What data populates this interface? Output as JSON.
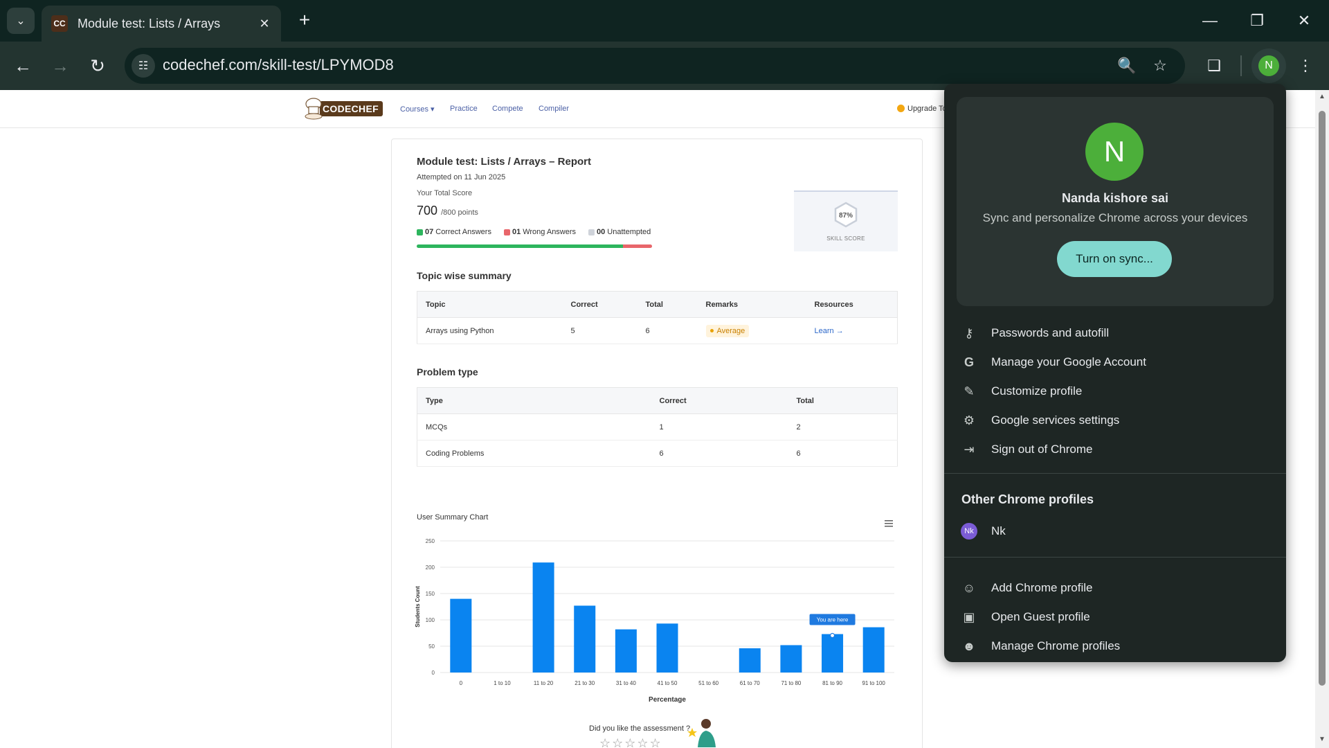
{
  "browser": {
    "tab_title": "Module test: Lists / Arrays",
    "tab_favicon": "CC",
    "url": "codechef.com/skill-test/LPYMOD8",
    "avatar_initial": "N"
  },
  "site": {
    "logo_text": "CODECHEF",
    "nav": [
      "Courses",
      "Practice",
      "Compete",
      "Compiler"
    ],
    "upgrade": "Upgrade To"
  },
  "report": {
    "title": "Module test: Lists / Arrays – Report",
    "attempted": "Attempted on 11 Jun 2025",
    "total_label": "Your Total Score",
    "score": "700",
    "score_max": "/800 points",
    "correct_count": "07",
    "correct_label": "Correct Answers",
    "wrong_count": "01",
    "wrong_label": "Wrong Answers",
    "unattempted_count": "00",
    "unattempted_label": "Unattempted",
    "progress_correct_fraction": 0.875,
    "progress_wrong_fraction": 0.125,
    "skill_percent": "87%",
    "skill_label": "SKILL SCORE",
    "colors": {
      "correct": "#2db55d",
      "wrong": "#e8666b",
      "unattempted": "#cfd3da"
    }
  },
  "topic_summary": {
    "title": "Topic wise summary",
    "headers": [
      "Topic",
      "Correct",
      "Total",
      "Remarks",
      "Resources"
    ],
    "rows": [
      {
        "topic": "Arrays using Python",
        "correct": "5",
        "total": "6",
        "remarks": "Average",
        "resources": "Learn →"
      }
    ]
  },
  "problem_type": {
    "title": "Problem type",
    "headers": [
      "Type",
      "Correct",
      "Total"
    ],
    "rows": [
      {
        "type": "MCQs",
        "correct": "1",
        "total": "2"
      },
      {
        "type": "Coding Problems",
        "correct": "6",
        "total": "6"
      }
    ]
  },
  "chart_data": {
    "type": "bar",
    "title": "User Summary Chart",
    "xlabel": "Percentage",
    "ylabel": "Students Count",
    "categories": [
      "0",
      "1 to 10",
      "11 to 20",
      "21 to 30",
      "31 to 40",
      "41 to 50",
      "51 to 60",
      "61 to 70",
      "71 to 80",
      "81 to 90",
      "91 to 100"
    ],
    "values": [
      140,
      0,
      209,
      127,
      82,
      93,
      0,
      46,
      52,
      73,
      86
    ],
    "ylim": [
      0,
      250
    ],
    "yticks": [
      0,
      50,
      100,
      150,
      200,
      250
    ],
    "grid": true,
    "color": "#0a84f0",
    "annotation": {
      "category": "81 to 90",
      "text": "You are here"
    }
  },
  "feedback": {
    "question": "Did you like the assessment ?",
    "stars": "☆☆☆☆☆"
  },
  "profile_menu": {
    "initial": "N",
    "name": "Nanda kishore sai",
    "subtitle": "Sync and personalize Chrome across your devices",
    "sync_button": "Turn on sync...",
    "items": [
      {
        "icon": "key-icon",
        "label": "Passwords and autofill"
      },
      {
        "icon": "google-g-icon",
        "label": "Manage your Google Account"
      },
      {
        "icon": "pencil-icon",
        "label": "Customize profile"
      },
      {
        "icon": "gear-icon",
        "label": "Google services settings"
      },
      {
        "icon": "sign-out-icon",
        "label": "Sign out of Chrome"
      }
    ],
    "other_profiles_title": "Other Chrome profiles",
    "other_profile": {
      "initials": "Nk",
      "label": "Nk"
    },
    "bottom_items": [
      {
        "icon": "add-person-icon",
        "label": "Add Chrome profile"
      },
      {
        "icon": "guest-icon",
        "label": "Open Guest profile"
      },
      {
        "icon": "manage-profiles-icon",
        "label": "Manage Chrome profiles"
      }
    ]
  }
}
